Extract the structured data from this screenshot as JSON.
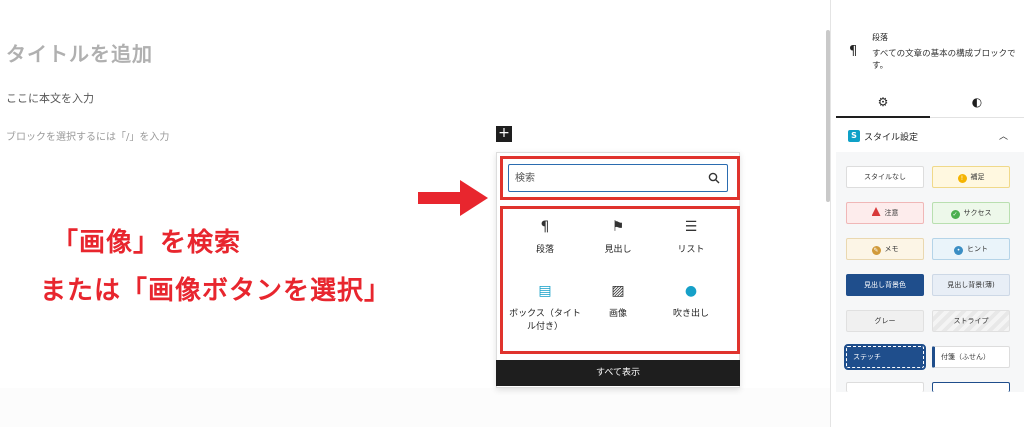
{
  "editor": {
    "title_placeholder": "タイトルを追加",
    "body_text": "ここに本文を入力",
    "block_hint": "ブロックを選択するには「/」を入力",
    "add_block_symbol": "+"
  },
  "annotation": {
    "line1": "「画像」を検索",
    "line2": "または「画像ボタンを選択」",
    "color": "#e8262e"
  },
  "inserter": {
    "search_placeholder": "検索",
    "blocks": [
      {
        "label": "段落",
        "icon": "paragraph-icon",
        "glyph": "¶"
      },
      {
        "label": "見出し",
        "icon": "bookmark-heading-icon",
        "glyph": "⚑"
      },
      {
        "label": "リスト",
        "icon": "list-icon",
        "glyph": "☰"
      },
      {
        "label": "ボックス（タイトル付き）",
        "icon": "box-title-icon",
        "glyph": "▤"
      },
      {
        "label": "画像",
        "icon": "image-icon",
        "glyph": "▨"
      },
      {
        "label": "吹き出し",
        "icon": "speech-bubble-icon",
        "glyph": "●"
      }
    ],
    "show_all": "すべて表示",
    "highlight_color": "#e0332d"
  },
  "sidebar": {
    "block_name": "段落",
    "block_description": "すべての文章の基本の構成ブロックです。",
    "tabs": [
      {
        "icon": "gear-icon",
        "glyph": "⚙"
      },
      {
        "icon": "contrast-icon",
        "glyph": "◐"
      }
    ],
    "panel_badge": "S",
    "panel_title": "スタイル設定",
    "styles": [
      {
        "label": "スタイルなし"
      },
      {
        "label": "補足"
      },
      {
        "label": "注意"
      },
      {
        "label": "サクセス"
      },
      {
        "label": "メモ"
      },
      {
        "label": "ヒント"
      },
      {
        "label": "見出し背景色"
      },
      {
        "label": "見出し背景(薄)"
      },
      {
        "label": "グレー"
      },
      {
        "label": "ストライプ"
      },
      {
        "label": "ステッチ"
      },
      {
        "label": "付箋（ふせん）"
      }
    ]
  }
}
